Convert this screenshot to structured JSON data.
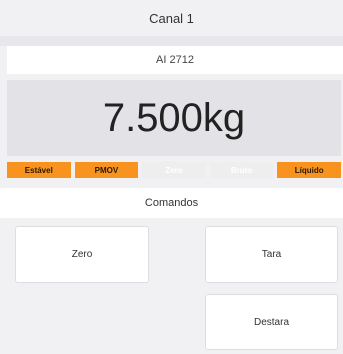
{
  "channel": {
    "title": "Canal 1"
  },
  "device": {
    "name": "AI 2712"
  },
  "weight": {
    "display": "7.500kg"
  },
  "status_flags": [
    {
      "label": "Estável",
      "active": true
    },
    {
      "label": "PMOV",
      "active": true
    },
    {
      "label": "Zero",
      "active": false
    },
    {
      "label": "Bruto",
      "active": false
    },
    {
      "label": "Líquido",
      "active": true
    }
  ],
  "commands": {
    "section_title": "Comandos",
    "zero_label": "Zero",
    "tara_label": "Tara",
    "destara_label": "Destara"
  },
  "colors": {
    "status_active": "#f7931e",
    "status_inactive": "#eeeeee"
  }
}
